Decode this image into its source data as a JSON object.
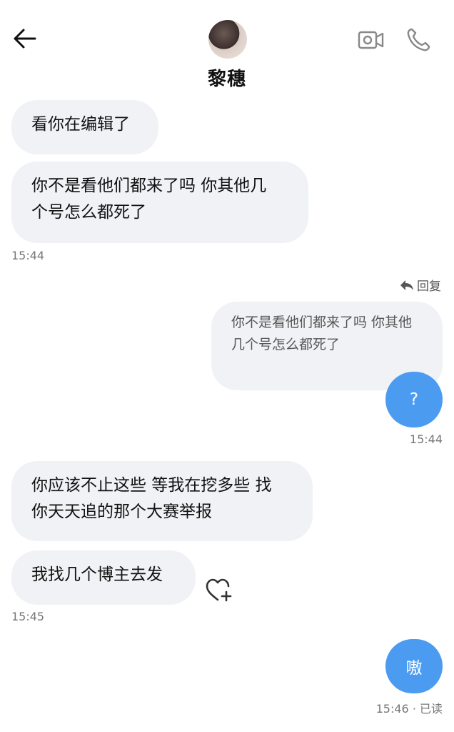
{
  "header": {
    "contact_name": "黎穗",
    "back_icon": "arrow-left-icon",
    "video_icon": "video-camera-icon",
    "call_icon": "phone-icon"
  },
  "messages": [
    {
      "from": "them",
      "text": "看你在编辑了"
    },
    {
      "from": "them",
      "text_line1": "你不是看他们都来了吗 你其他几",
      "text_line2": "个号怎么都死了"
    },
    {
      "time": "15:44"
    },
    {
      "reply_label": "回复"
    },
    {
      "from": "me",
      "quote_line1": "你不是看他们都来了吗 你其他",
      "quote_line2": "几个号怎么都死了"
    },
    {
      "from": "me",
      "text": "?"
    },
    {
      "time": "15:44"
    },
    {
      "from": "them",
      "text_line1": "你应该不止这些 等我在挖多些 找",
      "text_line2": "你天天追的那个大赛举报"
    },
    {
      "from": "them",
      "text": "我找几个博主去发"
    },
    {
      "time": "15:45"
    },
    {
      "from": "me",
      "text": "嗷"
    },
    {
      "time": "15:46 · 已读"
    }
  ],
  "colors": {
    "incoming_bubble": "#f1f2f5",
    "outgoing_bubble": "#4b9cf0",
    "timestamp": "#777777"
  }
}
